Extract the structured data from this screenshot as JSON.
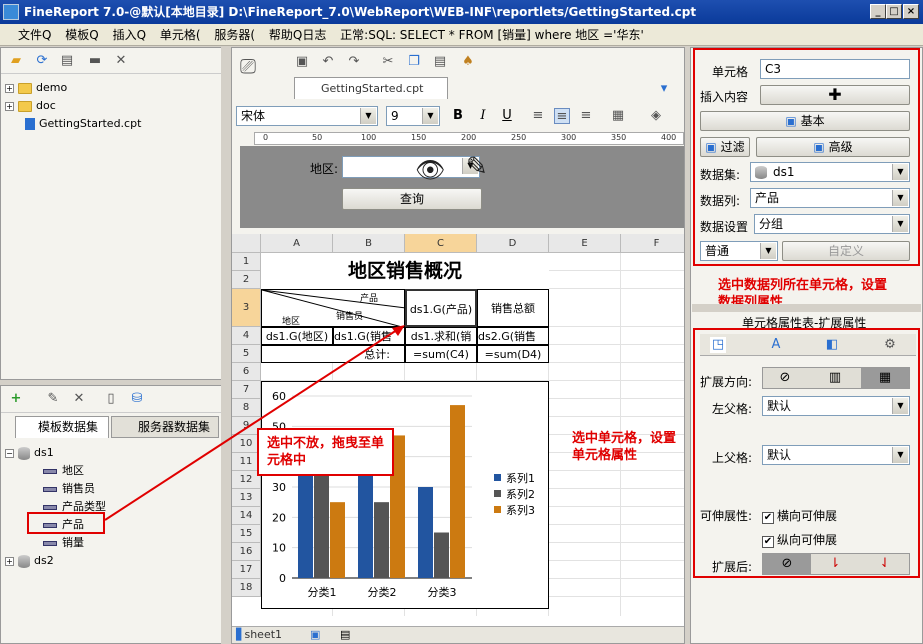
{
  "window": {
    "title": "FineReport 7.0-@默认[本地目录]    D:\\FineReport_7.0\\WebReport\\WEB-INF\\reportlets/GettingStarted.cpt",
    "min": "_",
    "max": "□",
    "close": "×"
  },
  "menu": [
    "文件Q",
    "模板Q",
    "插入Q",
    "单元格(",
    "服务器(",
    "帮助Q日志",
    "正常:SQL: SELECT * FROM [销量] where 地区 ='华东'"
  ],
  "filetree": {
    "items": [
      "demo",
      "doc",
      "GettingStarted.cpt"
    ]
  },
  "datasets": {
    "tabs": [
      "模板数据集",
      "服务器数据集"
    ],
    "ds1": "ds1",
    "fields": [
      "地区",
      "销售员",
      "产品类型",
      "产品",
      "销量"
    ],
    "ds2": "ds2"
  },
  "editor": {
    "tab": "GettingStarted.cpt",
    "font": "宋体",
    "size": "9",
    "bold": "B",
    "italic": "I",
    "underline": "U",
    "param_label": "地区:",
    "query_button": "查询",
    "sheet": "sheet1"
  },
  "grid": {
    "cols": [
      "A",
      "B",
      "C",
      "D",
      "E",
      "F"
    ],
    "rows": [
      "1",
      "2",
      "3",
      "4",
      "5",
      "6",
      "7",
      "8",
      "9",
      "10",
      "11",
      "12",
      "13",
      "14",
      "15",
      "16",
      "17",
      "18"
    ],
    "title": "地区销售概况",
    "diag_product": "产品",
    "diag_seller": "销售员",
    "diag_region": "地区",
    "c3": "ds1.G(产品)",
    "d3": "销售总额",
    "a4": "ds1.G(地区)",
    "b4": "ds1.G(销售",
    "c4": "ds1.求和(销",
    "d4": "ds2.G(销售",
    "a5": "总计:",
    "c5": "=sum(C4)",
    "d5": "=sum(D4)"
  },
  "chart_data": {
    "type": "bar",
    "categories": [
      "分类1",
      "分类2",
      "分类3"
    ],
    "series": [
      {
        "name": "系列1",
        "values": [
          43,
          35,
          30
        ],
        "color": "#2255a0"
      },
      {
        "name": "系列2",
        "values": [
          41,
          25,
          15
        ],
        "color": "#555555"
      },
      {
        "name": "系列3",
        "values": [
          25,
          47,
          57
        ],
        "color": "#cc7a11"
      }
    ],
    "yticks": [
      "0",
      "10",
      "20",
      "30",
      "40",
      "50",
      "60"
    ],
    "ylim": [
      0,
      60
    ],
    "legend": "right"
  },
  "props": {
    "cell_label": "单元格",
    "cell_value": "C3",
    "insert_label": "插入内容",
    "basic": "基本",
    "filter": "过滤",
    "advanced": "高级",
    "dataset_label": "数据集:",
    "dataset_value": "ds1",
    "column_label": "数据列:",
    "column_value": "产品",
    "setting_label": "数据设置",
    "setting_value": "分组",
    "normal": "普通",
    "custom": "自定义",
    "section_title": "单元格属性表-扩展属性",
    "expand_dir": "扩展方向:",
    "left_parent": "左父格:",
    "left_value": "默认",
    "up_parent": "上父格:",
    "up_value": "默认",
    "stretch": "可伸展性:",
    "h_stretch": "横向可伸展",
    "v_stretch": "纵向可伸展",
    "after_expand": "扩展后:"
  },
  "annotations": {
    "drag": "选中不放，拖曳至单元格中",
    "select_cell": "选中单元格，设置单元格属性",
    "select_col": "选中数据列所在单元格，设置数据列属性"
  }
}
